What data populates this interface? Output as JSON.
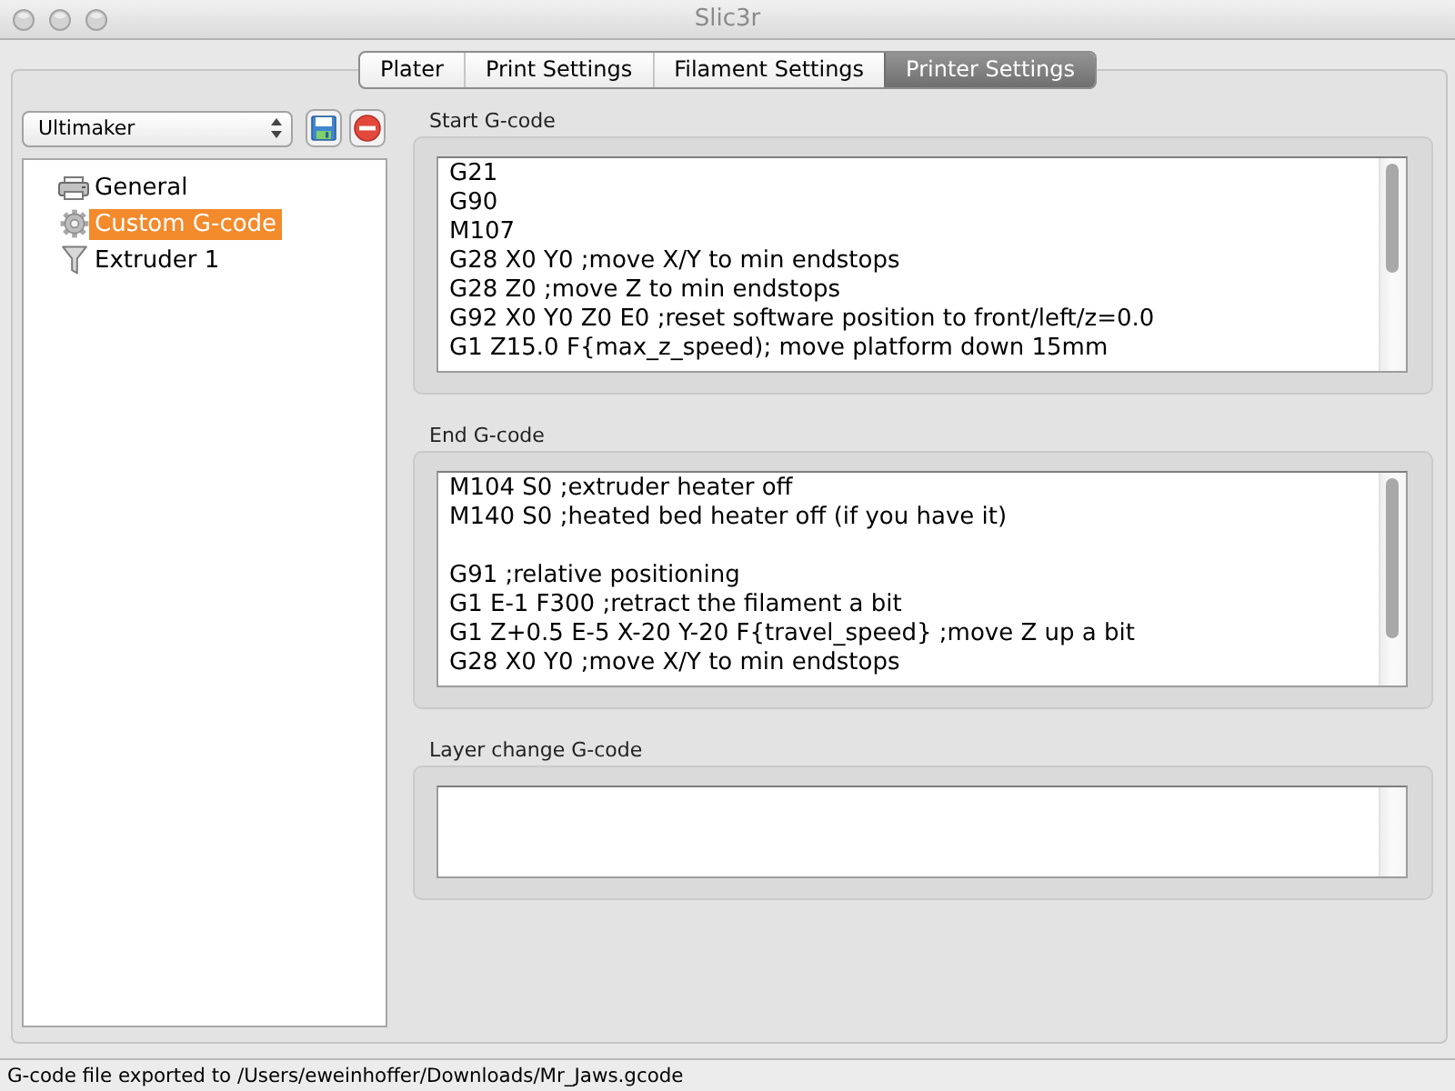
{
  "window": {
    "title": "Slic3r"
  },
  "tabs": [
    {
      "label": "Plater",
      "selected": false
    },
    {
      "label": "Print Settings",
      "selected": false
    },
    {
      "label": "Filament Settings",
      "selected": false
    },
    {
      "label": "Printer Settings",
      "selected": true
    }
  ],
  "sidebar": {
    "preset": {
      "value": "Ultimaker"
    },
    "items": [
      {
        "label": "General",
        "kind": "general",
        "selected": false
      },
      {
        "label": "Custom G-code",
        "kind": "gcode",
        "selected": true
      },
      {
        "label": "Extruder 1",
        "kind": "extruder",
        "selected": false
      }
    ]
  },
  "sections": [
    {
      "label": "Start G-code",
      "value": "G21\nG90\nM107\nG28 X0 Y0 ;move X/Y to min endstops\nG28 Z0 ;move Z to min endstops\nG92 X0 Y0 Z0 E0 ;reset software position to front/left/z=0.0\nG1 Z15.0 F{max_z_speed); move platform down 15mm"
    },
    {
      "label": "End G-code",
      "value": "M104 S0 ;extruder heater off\nM140 S0 ;heated bed heater off (if you have it)\n\nG91 ;relative positioning\nG1 E-1 F300 ;retract the filament a bit\nG1 Z+0.5 E-5 X-20 Y-20 F{travel_speed} ;move Z up a bit\nG28 X0 Y0 ;move X/Y to min endstops"
    },
    {
      "label": "Layer change G-code"
    }
  ],
  "status_bar": {
    "text": "G-code file exported to /Users/eweinhoffer/Downloads/Mr_Jaws.gcode"
  }
}
